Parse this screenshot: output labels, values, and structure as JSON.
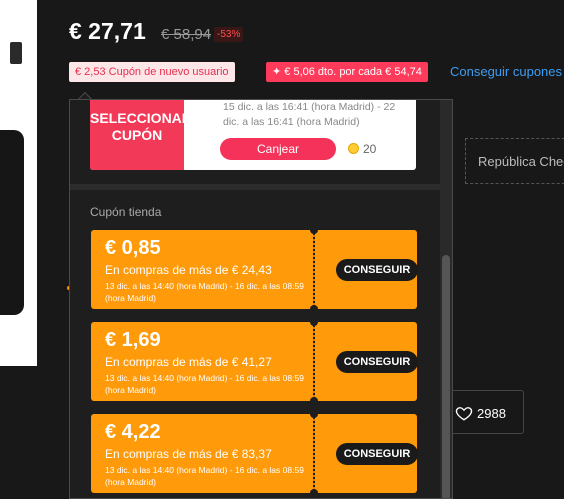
{
  "product": {
    "price": "€ 27,71",
    "original_price": "€ 58,94",
    "discount": "-53%"
  },
  "tags": {
    "new_user_coupon": "€ 2,53 Cupón de nuevo usuario",
    "bulk_discount": "✦ € 5,06 dto. por cada € 54,74",
    "more_coupons": "Conseguir cupones"
  },
  "shipping": {
    "region": "República Checa"
  },
  "wishlist": {
    "count": "2988"
  },
  "coupon_panel": {
    "top_coupon": {
      "select_label": "SELECCIONAR CUPÓN",
      "dates": "15 dic. a las 16:41 (hora Madrid) - 22 dic. a las 16:41 (hora Madrid)",
      "redeem_label": "Canjear",
      "coins": "20"
    },
    "section_title": "Cupón tienda",
    "store_coupons": [
      {
        "amount": "€ 0,85",
        "condition": "En compras de más de € 24,43",
        "validity": "13 dic. a las 14:40 (hora Madrid) - 16 dic. a las 08:59 (hora Madrid)",
        "button": "CONSEGUIR"
      },
      {
        "amount": "€ 1,69",
        "condition": "En compras de más de € 41,27",
        "validity": "13 dic. a las 14:40 (hora Madrid) - 16 dic. a las 08:59 (hora Madrid)",
        "button": "CONSEGUIR"
      },
      {
        "amount": "€ 4,22",
        "condition": "En compras de más de € 83,37",
        "validity": "13 dic. a las 14:40 (hora Madrid) - 16 dic. a las 08:59 (hora Madrid)",
        "button": "CONSEGUIR"
      }
    ]
  },
  "colors": {
    "coupon_orange": "#ff9a0a",
    "accent_red": "#f23a58",
    "link_blue": "#3d9df3",
    "background": "#181818"
  }
}
